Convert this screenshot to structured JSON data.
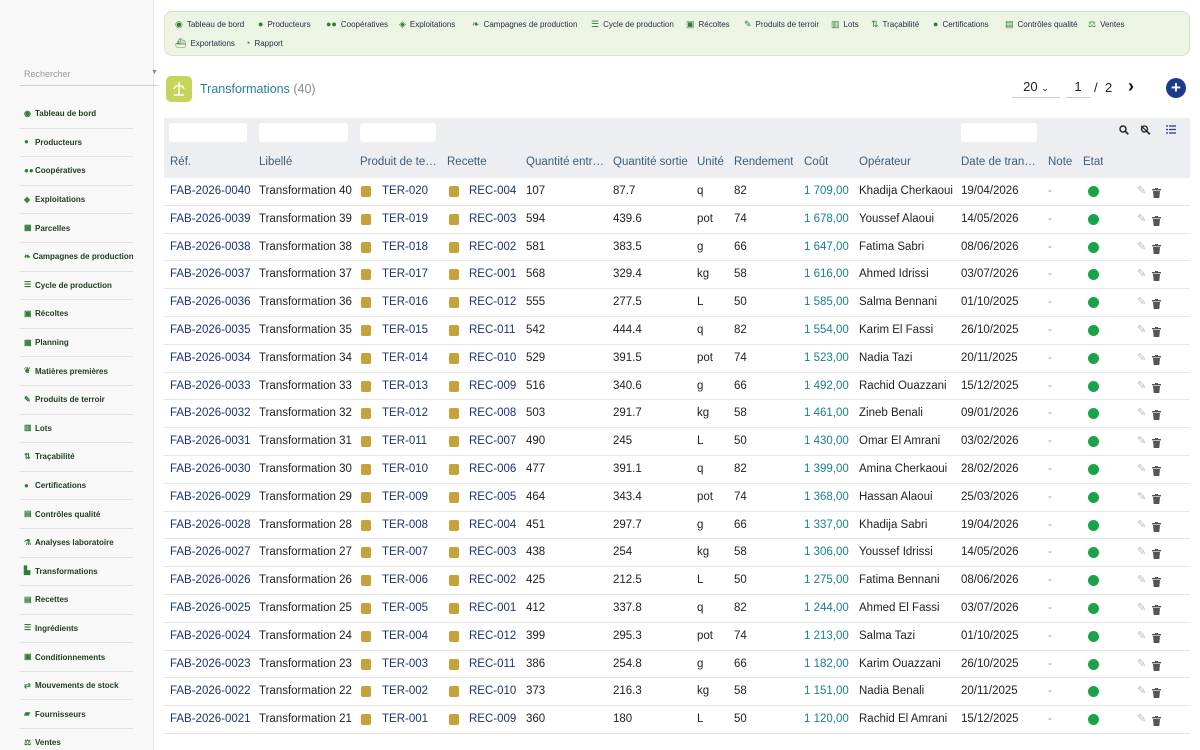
{
  "sidebar": {
    "search_placeholder": "Rechercher",
    "items": [
      {
        "label": "Tableau de bord",
        "icon": "dashboard-icon"
      },
      {
        "label": "Producteurs",
        "icon": "user-icon"
      },
      {
        "label": "Coopératives",
        "icon": "users-icon"
      },
      {
        "label": "Exploitations",
        "icon": "tractor-icon"
      },
      {
        "label": "Parcelles",
        "icon": "field-icon"
      },
      {
        "label": "Campagnes de production",
        "icon": "leaf-icon"
      },
      {
        "label": "Cycle de production",
        "icon": "list-icon"
      },
      {
        "label": "Récoltes",
        "icon": "basket-icon"
      },
      {
        "label": "Planning",
        "icon": "calendar-icon"
      },
      {
        "label": "Matières premières",
        "icon": "seedling-icon"
      },
      {
        "label": "Produits de terroir",
        "icon": "carrot-icon"
      },
      {
        "label": "Lots",
        "icon": "barcode-icon"
      },
      {
        "label": "Traçabilité",
        "icon": "trace-icon"
      },
      {
        "label": "Certifications",
        "icon": "certificate-icon"
      },
      {
        "label": "Contrôles qualité",
        "icon": "clipboard-icon"
      },
      {
        "label": "Analyses laboratoire",
        "icon": "flask-icon"
      },
      {
        "label": "Transformations",
        "icon": "industry-icon"
      },
      {
        "label": "Recettes",
        "icon": "book-icon"
      },
      {
        "label": "Ingrédients",
        "icon": "list-icon"
      },
      {
        "label": "Conditionnements",
        "icon": "box-icon"
      },
      {
        "label": "Mouvements de stock",
        "icon": "exchange-icon"
      },
      {
        "label": "Fournisseurs",
        "icon": "truck-icon"
      },
      {
        "label": "Ventes",
        "icon": "sales-icon"
      }
    ]
  },
  "topmenu": {
    "items": [
      {
        "label": "Tableau de bord",
        "icon": "dashboard-icon"
      },
      {
        "label": "Producteurs",
        "icon": "user-icon"
      },
      {
        "label": "Coopératives",
        "icon": "users-icon"
      },
      {
        "label": "Exploitations",
        "icon": "tractor-icon"
      },
      {
        "label": "Campagnes de production",
        "icon": "leaf-icon"
      },
      {
        "label": "Cycle de production",
        "icon": "list-icon"
      },
      {
        "label": "Récoltes",
        "icon": "basket-icon"
      },
      {
        "label": "Produits de terroir",
        "icon": "carrot-icon"
      },
      {
        "label": "Lots",
        "icon": "barcode-icon"
      },
      {
        "label": "Traçabilité",
        "icon": "trace-icon"
      },
      {
        "label": "Certifications",
        "icon": "certificate-icon"
      },
      {
        "label": "Contrôles qualité",
        "icon": "clipboard-icon"
      },
      {
        "label": "Ventes",
        "icon": "sales-icon"
      },
      {
        "label": "Exportations",
        "icon": "ship-icon"
      },
      {
        "label": "Rapport",
        "icon": "chart-icon"
      }
    ]
  },
  "header": {
    "title": "Transformations",
    "count": "(40)",
    "page_size": "20",
    "page_current": "1",
    "page_sep": "/",
    "page_total": "2",
    "accent_color": "#2b7f8f"
  },
  "table": {
    "columns": [
      "Réf.",
      "Libellé",
      "Produit de te…",
      "Recette",
      "Quantité entr…",
      "Quantité sortie",
      "Unité",
      "Rendement",
      "Coût",
      "Opérateur",
      "Date de tran…",
      "Note",
      "État"
    ],
    "rows": [
      {
        "ref": "FAB-2026-0040",
        "label": "Transformation 40",
        "product": "TER-020",
        "recipe": "REC-004",
        "qty_in": "107",
        "qty_out": "87.7",
        "unit": "q",
        "yield": "82",
        "cost": "1 709,00",
        "operator": "Khadija Cherkaoui",
        "date": "19/04/2026",
        "note": "-"
      },
      {
        "ref": "FAB-2026-0039",
        "label": "Transformation 39",
        "product": "TER-019",
        "recipe": "REC-003",
        "qty_in": "594",
        "qty_out": "439.6",
        "unit": "pot",
        "yield": "74",
        "cost": "1 678,00",
        "operator": "Youssef Alaoui",
        "date": "14/05/2026",
        "note": "-"
      },
      {
        "ref": "FAB-2026-0038",
        "label": "Transformation 38",
        "product": "TER-018",
        "recipe": "REC-002",
        "qty_in": "581",
        "qty_out": "383.5",
        "unit": "g",
        "yield": "66",
        "cost": "1 647,00",
        "operator": "Fatima Sabri",
        "date": "08/06/2026",
        "note": "-"
      },
      {
        "ref": "FAB-2026-0037",
        "label": "Transformation 37",
        "product": "TER-017",
        "recipe": "REC-001",
        "qty_in": "568",
        "qty_out": "329.4",
        "unit": "kg",
        "yield": "58",
        "cost": "1 616,00",
        "operator": "Ahmed Idrissi",
        "date": "03/07/2026",
        "note": "-"
      },
      {
        "ref": "FAB-2026-0036",
        "label": "Transformation 36",
        "product": "TER-016",
        "recipe": "REC-012",
        "qty_in": "555",
        "qty_out": "277.5",
        "unit": "L",
        "yield": "50",
        "cost": "1 585,00",
        "operator": "Salma Bennani",
        "date": "01/10/2025",
        "note": "-"
      },
      {
        "ref": "FAB-2026-0035",
        "label": "Transformation 35",
        "product": "TER-015",
        "recipe": "REC-011",
        "qty_in": "542",
        "qty_out": "444.4",
        "unit": "q",
        "yield": "82",
        "cost": "1 554,00",
        "operator": "Karim El Fassi",
        "date": "26/10/2025",
        "note": "-"
      },
      {
        "ref": "FAB-2026-0034",
        "label": "Transformation 34",
        "product": "TER-014",
        "recipe": "REC-010",
        "qty_in": "529",
        "qty_out": "391.5",
        "unit": "pot",
        "yield": "74",
        "cost": "1 523,00",
        "operator": "Nadia Tazi",
        "date": "20/11/2025",
        "note": "-"
      },
      {
        "ref": "FAB-2026-0033",
        "label": "Transformation 33",
        "product": "TER-013",
        "recipe": "REC-009",
        "qty_in": "516",
        "qty_out": "340.6",
        "unit": "g",
        "yield": "66",
        "cost": "1 492,00",
        "operator": "Rachid Ouazzani",
        "date": "15/12/2025",
        "note": "-"
      },
      {
        "ref": "FAB-2026-0032",
        "label": "Transformation 32",
        "product": "TER-012",
        "recipe": "REC-008",
        "qty_in": "503",
        "qty_out": "291.7",
        "unit": "kg",
        "yield": "58",
        "cost": "1 461,00",
        "operator": "Zineb Benali",
        "date": "09/01/2026",
        "note": "-"
      },
      {
        "ref": "FAB-2026-0031",
        "label": "Transformation 31",
        "product": "TER-011",
        "recipe": "REC-007",
        "qty_in": "490",
        "qty_out": "245",
        "unit": "L",
        "yield": "50",
        "cost": "1 430,00",
        "operator": "Omar El Amrani",
        "date": "03/02/2026",
        "note": "-"
      },
      {
        "ref": "FAB-2026-0030",
        "label": "Transformation 30",
        "product": "TER-010",
        "recipe": "REC-006",
        "qty_in": "477",
        "qty_out": "391.1",
        "unit": "q",
        "yield": "82",
        "cost": "1 399,00",
        "operator": "Amina Cherkaoui",
        "date": "28/02/2026",
        "note": "-"
      },
      {
        "ref": "FAB-2026-0029",
        "label": "Transformation 29",
        "product": "TER-009",
        "recipe": "REC-005",
        "qty_in": "464",
        "qty_out": "343.4",
        "unit": "pot",
        "yield": "74",
        "cost": "1 368,00",
        "operator": "Hassan Alaoui",
        "date": "25/03/2026",
        "note": "-"
      },
      {
        "ref": "FAB-2026-0028",
        "label": "Transformation 28",
        "product": "TER-008",
        "recipe": "REC-004",
        "qty_in": "451",
        "qty_out": "297.7",
        "unit": "g",
        "yield": "66",
        "cost": "1 337,00",
        "operator": "Khadija Sabri",
        "date": "19/04/2026",
        "note": "-"
      },
      {
        "ref": "FAB-2026-0027",
        "label": "Transformation 27",
        "product": "TER-007",
        "recipe": "REC-003",
        "qty_in": "438",
        "qty_out": "254",
        "unit": "kg",
        "yield": "58",
        "cost": "1 306,00",
        "operator": "Youssef Idrissi",
        "date": "14/05/2026",
        "note": "-"
      },
      {
        "ref": "FAB-2026-0026",
        "label": "Transformation 26",
        "product": "TER-006",
        "recipe": "REC-002",
        "qty_in": "425",
        "qty_out": "212.5",
        "unit": "L",
        "yield": "50",
        "cost": "1 275,00",
        "operator": "Fatima Bennani",
        "date": "08/06/2026",
        "note": "-"
      },
      {
        "ref": "FAB-2026-0025",
        "label": "Transformation 25",
        "product": "TER-005",
        "recipe": "REC-001",
        "qty_in": "412",
        "qty_out": "337.8",
        "unit": "q",
        "yield": "82",
        "cost": "1 244,00",
        "operator": "Ahmed El Fassi",
        "date": "03/07/2026",
        "note": "-"
      },
      {
        "ref": "FAB-2026-0024",
        "label": "Transformation 24",
        "product": "TER-004",
        "recipe": "REC-012",
        "qty_in": "399",
        "qty_out": "295.3",
        "unit": "pot",
        "yield": "74",
        "cost": "1 213,00",
        "operator": "Salma Tazi",
        "date": "01/10/2025",
        "note": "-"
      },
      {
        "ref": "FAB-2026-0023",
        "label": "Transformation 23",
        "product": "TER-003",
        "recipe": "REC-011",
        "qty_in": "386",
        "qty_out": "254.8",
        "unit": "g",
        "yield": "66",
        "cost": "1 182,00",
        "operator": "Karim Ouazzani",
        "date": "26/10/2025",
        "note": "-"
      },
      {
        "ref": "FAB-2026-0022",
        "label": "Transformation 22",
        "product": "TER-002",
        "recipe": "REC-010",
        "qty_in": "373",
        "qty_out": "216.3",
        "unit": "kg",
        "yield": "58",
        "cost": "1 151,00",
        "operator": "Nadia Benali",
        "date": "20/11/2025",
        "note": "-"
      },
      {
        "ref": "FAB-2026-0021",
        "label": "Transformation 21",
        "product": "TER-001",
        "recipe": "REC-009",
        "qty_in": "360",
        "qty_out": "180",
        "unit": "L",
        "yield": "50",
        "cost": "1 120,00",
        "operator": "Rachid El Amrani",
        "date": "15/12/2025",
        "note": "-"
      }
    ],
    "status_color": "#1aa34a",
    "link_color": "#1e3272",
    "cost_color": "#1a7f8a"
  }
}
